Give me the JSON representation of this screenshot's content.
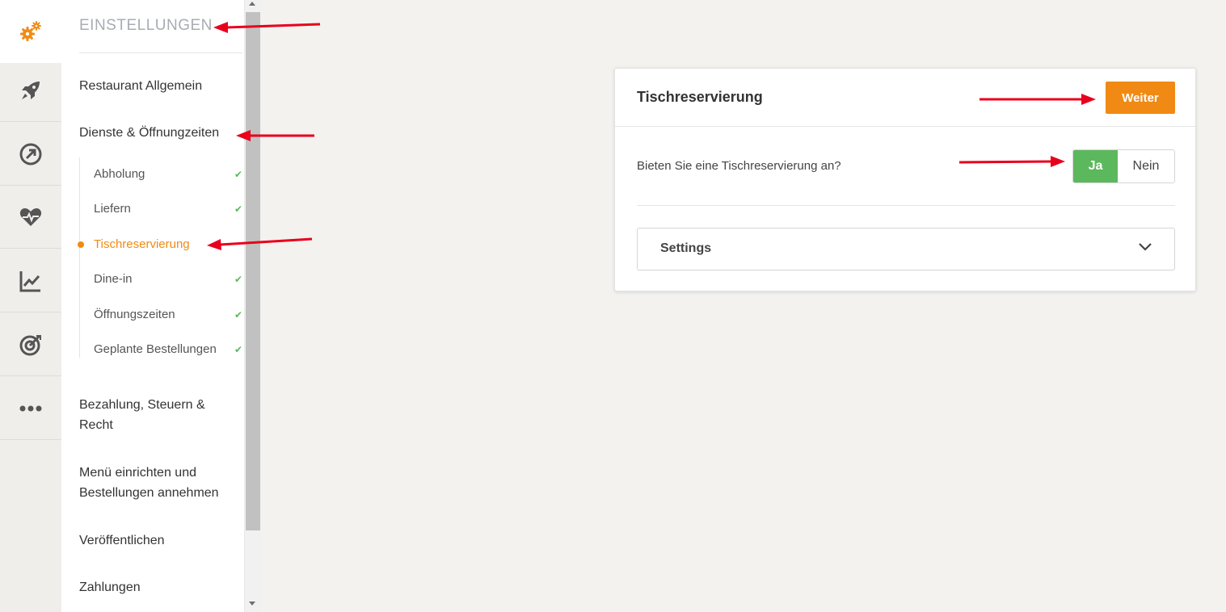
{
  "sidebar_rail": {
    "items": [
      {
        "name": "settings",
        "icon": "gears-icon",
        "active": true
      },
      {
        "name": "launch",
        "icon": "rocket-icon"
      },
      {
        "name": "growth",
        "icon": "circle-arrow-icon"
      },
      {
        "name": "health",
        "icon": "heart-pulse-icon"
      },
      {
        "name": "analytics",
        "icon": "line-chart-icon"
      },
      {
        "name": "marketing",
        "icon": "target-icon"
      },
      {
        "name": "more",
        "icon": "more-dots-icon"
      }
    ]
  },
  "settings_panel": {
    "title": "EINSTELLUNGEN",
    "items": {
      "restaurant_allgemein": "Restaurant Allgemein",
      "dienste": "Dienste & Öffnungzeiten",
      "bezahlung": "Bezahlung, Steuern & Recht",
      "menu": "Menü einrichten und Bestellungen annehmen",
      "veroeffentlichen": "Veröffentlichen",
      "zahlungen": "Zahlungen"
    },
    "sub_items": [
      {
        "label": "Abholung",
        "done": true
      },
      {
        "label": "Liefern",
        "done": true
      },
      {
        "label": "Tischreservierung",
        "active": true
      },
      {
        "label": "Dine-in",
        "done": true
      },
      {
        "label": "Öffnungszeiten",
        "done": true
      },
      {
        "label": "Geplante Bestellungen",
        "done": true
      }
    ]
  },
  "card": {
    "title": "Tischreservierung",
    "next_button": "Weiter",
    "question": "Bieten Sie eine Tischreservierung an?",
    "toggle": {
      "yes": "Ja",
      "no": "Nein",
      "selected": "Ja"
    },
    "accordion_label": "Settings"
  },
  "colors": {
    "accent_orange": "#f08a14",
    "success_green": "#5cb85c",
    "annotation_red": "#e8001c"
  }
}
